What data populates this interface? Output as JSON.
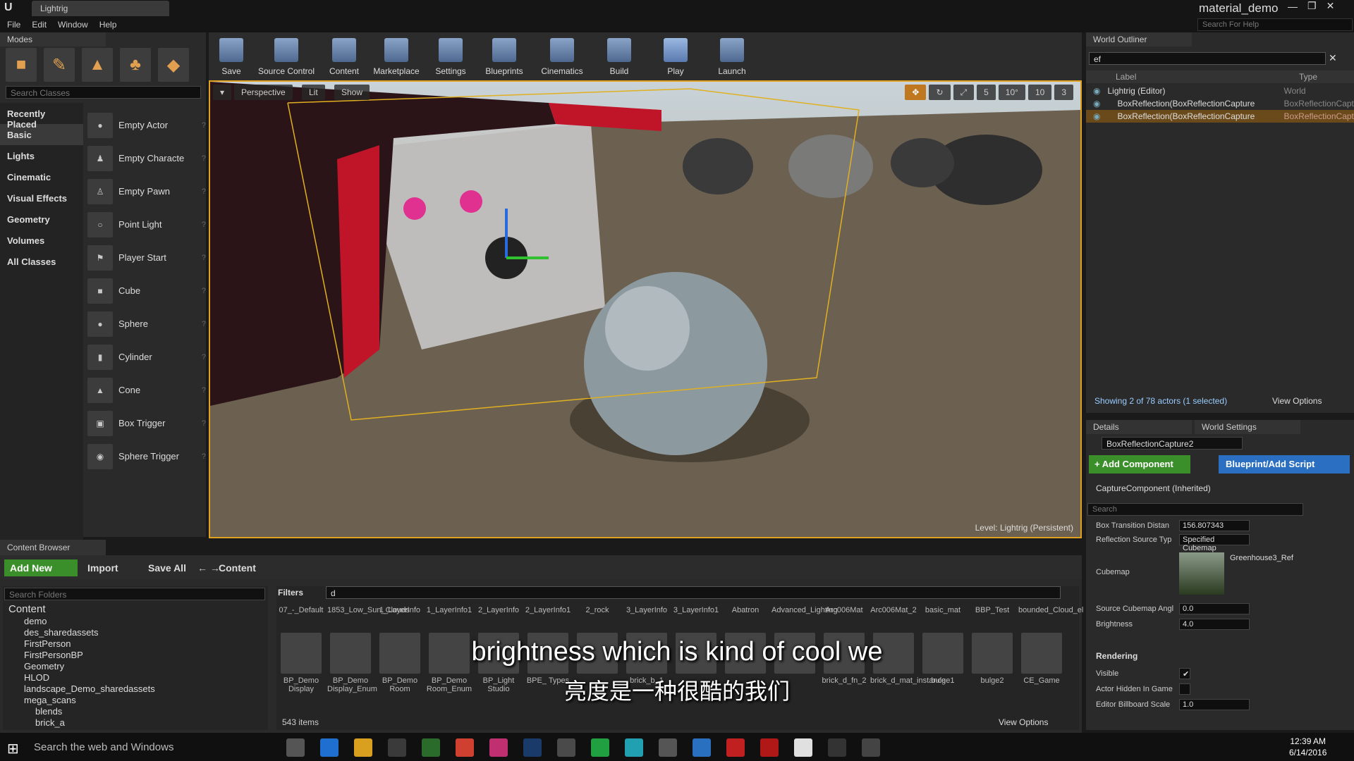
{
  "app": {
    "tab_title": "Lightrig",
    "project": "material_demo",
    "help_search_placeholder": "Search For Help"
  },
  "menu": [
    "File",
    "Edit",
    "Window",
    "Help"
  ],
  "modes": {
    "tab": "Modes",
    "search_placeholder": "Search Classes",
    "categories": [
      "Recently Placed",
      "Basic",
      "Lights",
      "Cinematic",
      "Visual Effects",
      "Geometry",
      "Volumes",
      "All Classes"
    ],
    "selected_category": "Basic",
    "actors": [
      "Empty Actor",
      "Empty Characte",
      "Empty Pawn",
      "Point Light",
      "Player Start",
      "Cube",
      "Sphere",
      "Cylinder",
      "Cone",
      "Box Trigger",
      "Sphere Trigger"
    ]
  },
  "toolbar": [
    "Save",
    "Source Control",
    "Content",
    "Marketplace",
    "Settings",
    "Blueprints",
    "Cinematics",
    "Build",
    "Play",
    "Launch"
  ],
  "viewport": {
    "perspective": "Perspective",
    "lit": "Lit",
    "show": "Show",
    "snap_grid": "5",
    "snap_rot": "10°",
    "snap_scale": "10",
    "cam_speed": "3",
    "level": "Level:  Lightrig (Persistent)"
  },
  "outliner": {
    "tab": "World Outliner",
    "search_value": "ef",
    "col_label": "Label",
    "col_type": "Type",
    "rows": [
      {
        "label": "Lightrig (Editor)",
        "type": "World"
      },
      {
        "label": "BoxReflection(BoxReflectionCapture",
        "type": "BoxReflectionCapt"
      },
      {
        "label": "BoxReflection(BoxReflectionCapture",
        "type": "BoxReflectionCapt"
      }
    ],
    "status": "Showing 2 of 78 actors (1 selected)",
    "view_options": "View Options"
  },
  "details": {
    "tab": "Details",
    "world_settings_tab": "World Settings",
    "object_name": "BoxReflectionCapture2",
    "add_component": "+ Add Component",
    "blueprint_script": "Blueprint/Add Script",
    "capture_component": "CaptureComponent (Inherited)",
    "search_placeholder": "Search",
    "props": [
      {
        "label": "Box Transition Distan",
        "value": "156.807343"
      },
      {
        "label": "Reflection Source Typ",
        "value": "Specified Cubemap"
      },
      {
        "label": "Source Cubemap Angl",
        "value": "0.0"
      },
      {
        "label": "Brightness",
        "value": "4.0"
      }
    ],
    "cubemap_label": "Cubemap",
    "cubemap_value": "Greenhouse3_Ref",
    "rendering": "Rendering",
    "render_props": [
      {
        "label": "Visible",
        "value": "✔"
      },
      {
        "label": "Actor Hidden In Game",
        "value": ""
      },
      {
        "label": "Editor Billboard Scale",
        "value": "1.0"
      }
    ]
  },
  "content_browser": {
    "tab": "Content Browser",
    "add_new": "Add New",
    "import": "Import",
    "save_all": "Save All",
    "path": "Content",
    "search_folders_placeholder": "Search Folders",
    "filters": "Filters",
    "asset_search": "d",
    "folders": [
      "Content",
      "demo",
      "des_sharedassets",
      "FirstPerson",
      "FirstPersonBP",
      "Geometry",
      "HLOD",
      "landscape_Demo_sharedassets",
      "mega_scans",
      "blends",
      "brick_a"
    ],
    "assets_row1": [
      "07_-_Default",
      "1853_Low_Sun_Clouds",
      "1_LayerInfo",
      "1_LayerInfo1",
      "2_LayerInfo",
      "2_LayerInfo1",
      "2_rock",
      "3_LayerInfo",
      "3_LayerInfo1",
      "Abatron",
      "Advanced_Lighting",
      "Arc006Mat",
      "Arc006Mat_2",
      "basic_mat",
      "BBP_Test",
      "bounded_Cloud_el"
    ],
    "assets_row2": [
      "BP_Demo Display",
      "BP_Demo Display_Enum",
      "BP_Demo Room",
      "BP_Demo Room_Enum",
      "BP_Light Studio",
      "BPE_ Types",
      "",
      "brick_b_1",
      "",
      "",
      "",
      "brick_d_fn_2",
      "brick_d_mat_instance",
      "bulge1",
      "bulge2",
      "CE_Game"
    ],
    "item_count": "543 items",
    "view_options": "View Options"
  },
  "subtitles": {
    "en": "brightness which is kind of cool we",
    "zh": "亮度是一种很酷的我们"
  },
  "taskbar": {
    "search": "Search the web and Windows",
    "time": "12:39 AM",
    "date": "6/14/2016"
  }
}
